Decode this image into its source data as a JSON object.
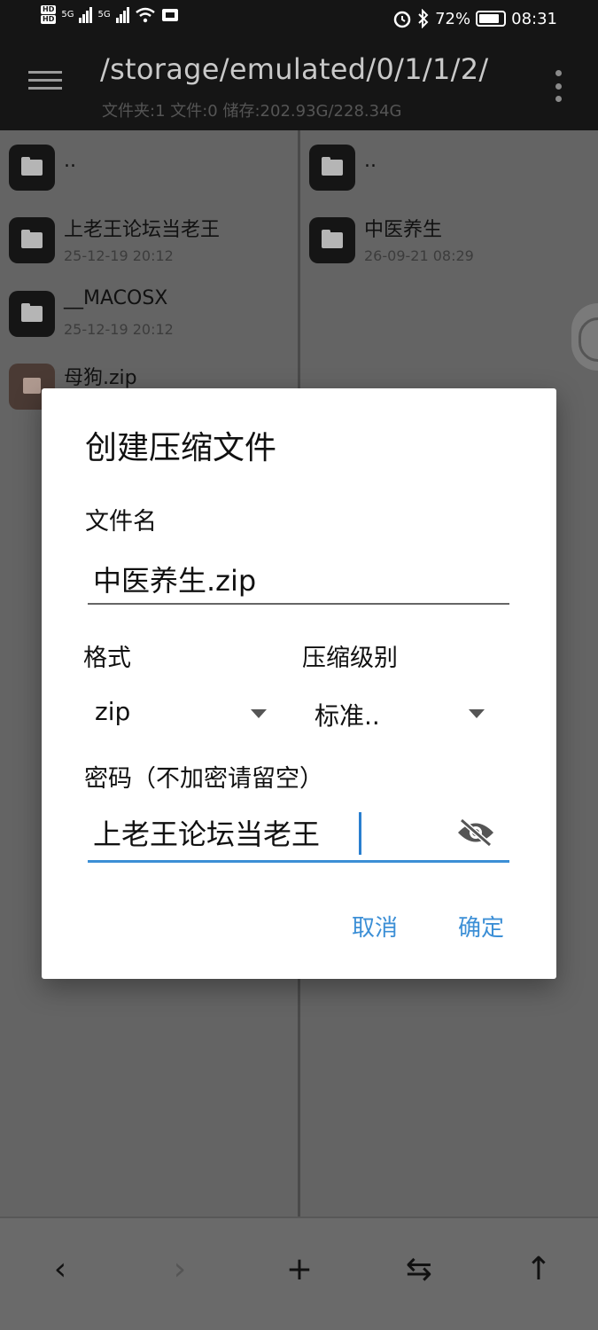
{
  "status_bar": {
    "hd1": "HD",
    "hd2": "HD",
    "net1": "5G",
    "net2": "5G",
    "battery_pct": "72%",
    "time": "08:31"
  },
  "app_bar": {
    "path": "/storage/emulated/0/1/1/2/",
    "stats": "文件夹:1 文件:0 储存:202.93G/228.34G"
  },
  "left_pane": {
    "items": [
      {
        "name": "..",
        "date": "",
        "icon": "folder-icon"
      },
      {
        "name": "上老王论坛当老王",
        "date": "25-12-19 20:12",
        "icon": "folder-icon"
      },
      {
        "name": "__MACOSX",
        "date": "25-12-19 20:12",
        "icon": "folder-icon"
      },
      {
        "name": "母狗.zip",
        "date": "",
        "icon": "archive-icon"
      }
    ]
  },
  "right_pane": {
    "items": [
      {
        "name": "..",
        "date": "",
        "icon": "folder-icon"
      },
      {
        "name": "中医养生",
        "date": "26-09-21 08:29",
        "icon": "folder-icon"
      }
    ]
  },
  "dialog": {
    "title": "创建压缩文件",
    "filename_label": "文件名",
    "filename_value": "中医养生.zip",
    "format_label": "格式",
    "format_value": "zip",
    "level_label": "压缩级别",
    "level_value": "标准..",
    "password_label": "密码（不加密请留空）",
    "password_value": "上老王论坛当老王",
    "cancel_label": "取消",
    "ok_label": "确定"
  },
  "bottom_nav": {
    "back": "‹",
    "forward": "›",
    "add": "+",
    "swap": "⇆",
    "up": "↑"
  },
  "colors": {
    "accent": "#3c8fd6",
    "bar": "#151515",
    "scrim": "#646464"
  }
}
